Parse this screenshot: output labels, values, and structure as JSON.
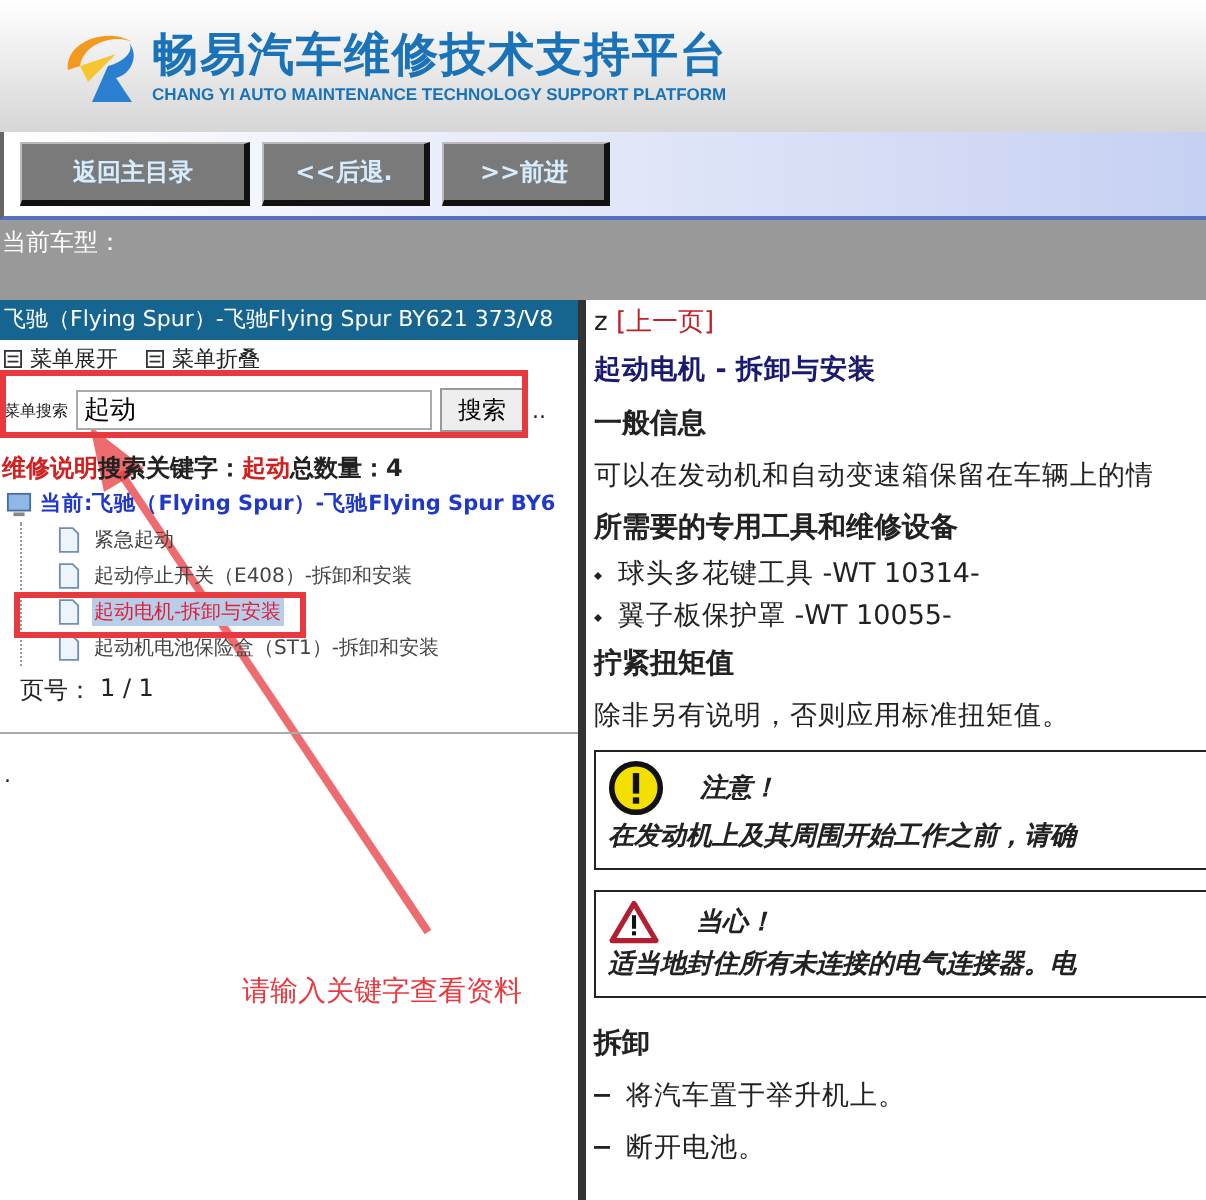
{
  "header": {
    "title": "畅易汽车维修技术支持平台",
    "subtitle": "CHANG YI AUTO MAINTENANCE TECHNOLOGY SUPPORT PLATFORM"
  },
  "nav_buttons": [
    "返回主目录",
    "<<后退.",
    ">>前进"
  ],
  "current_model_label": "当前车型：",
  "left_panel": {
    "title": "飞驰（Flying Spur）-飞驰Flying Spur BY621 373/V8",
    "menu_toggles": [
      "菜单展开",
      "菜单折叠"
    ],
    "search": {
      "label": "菜单搜索",
      "value": "起动",
      "button": "搜索",
      "extra": ".."
    },
    "result": {
      "source": "维修说明",
      "keyword_label": "搜索关键字：",
      "keyword": "起动",
      "count_label": "总数量：",
      "count": "4"
    },
    "tree": {
      "label": "当前:飞驰（Flying Spur）-飞驰Flying Spur BY6",
      "children": [
        {
          "label": "紧急起动",
          "selected": false
        },
        {
          "label": "起动停止开关（E408）-拆卸和安装",
          "selected": false
        },
        {
          "label": "起动电机-拆卸与安装",
          "selected": true
        },
        {
          "label": "起动机电池保险盒（ST1）-拆卸和安装",
          "selected": false
        }
      ]
    },
    "page_label": "页号：",
    "page_value": "1 / 1",
    "footer_mark": "."
  },
  "content": {
    "prefix": "z",
    "back_link": "[上一页]",
    "blocks": [
      {
        "kind": "title",
        "text": "起动电机 - 拆卸与安装"
      },
      {
        "kind": "heading",
        "text": "一般信息"
      },
      {
        "kind": "paragraph",
        "text": "可以在发动机和自动变速箱保留在车辆上的情"
      },
      {
        "kind": "heading",
        "text": "所需要的专用工具和维修设备"
      },
      {
        "kind": "bullets",
        "items": [
          "球头多花键工具 -WT 10314-",
          "翼子板保护罩 -WT 10055-"
        ]
      },
      {
        "kind": "heading",
        "text": "拧紧扭矩值"
      },
      {
        "kind": "paragraph",
        "text": "除非另有说明，否则应用标准扭矩值。"
      },
      {
        "kind": "attention_notice",
        "title": "注意！",
        "text": "在发动机上及其周围开始工作之前，请确"
      },
      {
        "kind": "caution_notice",
        "title": "当心！",
        "text": "适当地封住所有未连接的电气连接器。电"
      },
      {
        "kind": "heading",
        "text": "拆卸"
      },
      {
        "kind": "steps",
        "items": [
          "将汽车置于举升机上。",
          "断开电池。"
        ]
      }
    ]
  },
  "annotation": {
    "text": "请输入关键字查看资料"
  }
}
